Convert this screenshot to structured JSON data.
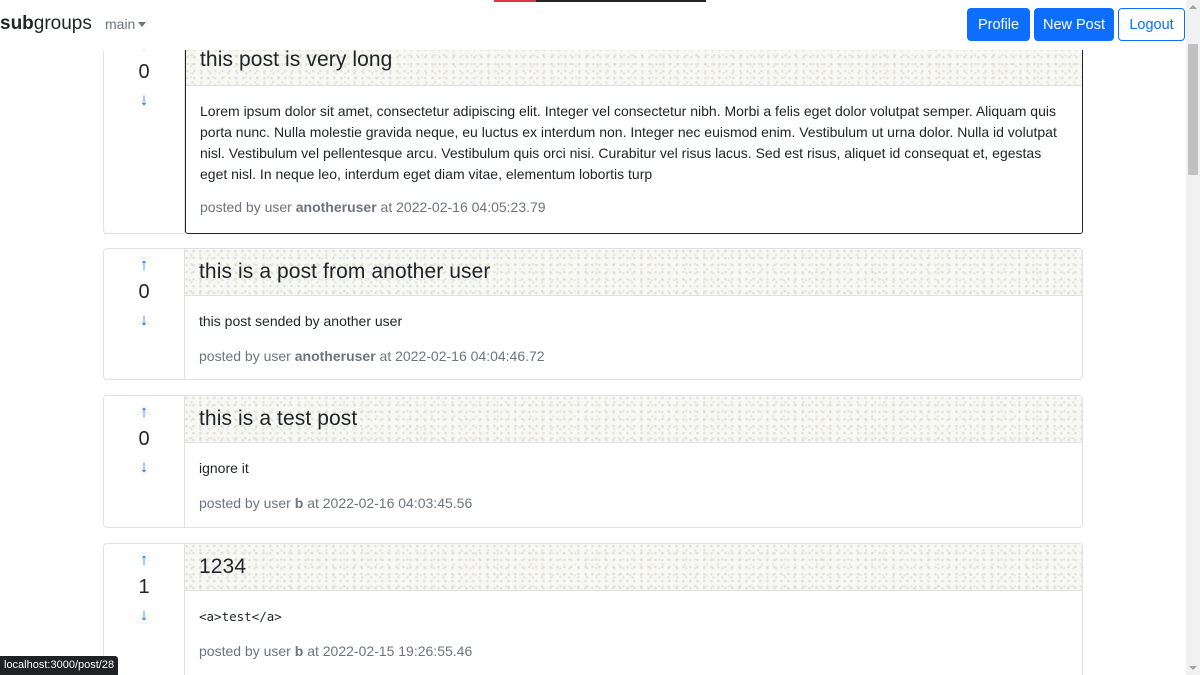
{
  "navbar": {
    "brand_bold": "sub",
    "brand_rest": "groups",
    "group_selector": "main",
    "buttons": {
      "profile": "Profile",
      "new_post": "New Post",
      "logout": "Logout"
    }
  },
  "posts": [
    {
      "score": "0",
      "title": "this post is very long",
      "body": "Lorem ipsum dolor sit amet, consectetur adipiscing elit. Integer vel consectetur nibh. Morbi a felis eget dolor volutpat semper. Aliquam quis porta nunc. Nulla molestie gravida neque, eu luctus ex interdum non. Integer nec euismod enim. Vestibulum ut urna dolor. Nulla id volutpat nisl. Vestibulum vel pellentesque arcu. Vestibulum quis orci nisi. Curabitur vel risus lacus. Sed est risus, aliquet id consequat et, egestas eget nisl. In neque leo, interdum eget diam vitae, elementum lobortis turp",
      "posted_by_prefix": "posted by user",
      "author": "anotheruser",
      "at_prefix": "at",
      "timestamp": "2022-02-16 04:05:23.79"
    },
    {
      "score": "0",
      "title": "this is a post from another user",
      "body": "this post sended by another user",
      "posted_by_prefix": "posted by user",
      "author": "anotheruser",
      "at_prefix": "at",
      "timestamp": "2022-02-16 04:04:46.72"
    },
    {
      "score": "0",
      "title": "this is a test post",
      "body": "ignore it",
      "posted_by_prefix": "posted by user",
      "author": "b",
      "at_prefix": "at",
      "timestamp": "2022-02-16 04:03:45.56"
    },
    {
      "score": "1",
      "title": "1234",
      "body": "<a>test</a>",
      "posted_by_prefix": "posted by user",
      "author": "b",
      "at_prefix": "at",
      "timestamp": "2022-02-15 19:26:55.46"
    }
  ],
  "vote_icons": {
    "up": "arrow-up-icon",
    "down": "arrow-down-icon",
    "up_glyph": "↑",
    "down_glyph": "↓"
  },
  "status_bar": {
    "url": "localhost:3000/post/28"
  },
  "colors": {
    "primary": "#0d6efd",
    "muted": "#6c757d",
    "header_bg": "#f7f7f3"
  }
}
